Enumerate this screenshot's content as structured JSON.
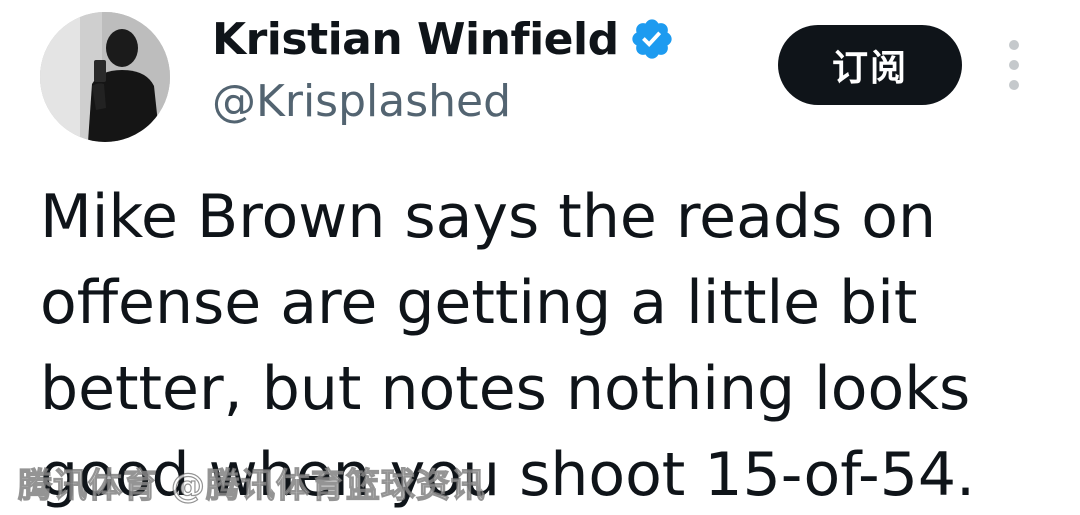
{
  "tweet": {
    "author": {
      "display_name": "Kristian Winfield",
      "handle": "@Krisplashed",
      "verified_icon": "verified-badge-icon",
      "verified_color": "#1d9bf0"
    },
    "subscribe_label": "订阅",
    "more_icon": "more-options-icon",
    "text": "Mike Brown says the reads on offense are getting a little bit better, but notes nothing looks good when you shoot 15-of-54."
  },
  "watermark": {
    "text": "腾讯体育 @腾讯体育篮球资讯"
  },
  "colors": {
    "text_primary": "#0f1419",
    "text_secondary": "#536471",
    "button_bg": "#0f1419",
    "button_text": "#ffffff"
  }
}
